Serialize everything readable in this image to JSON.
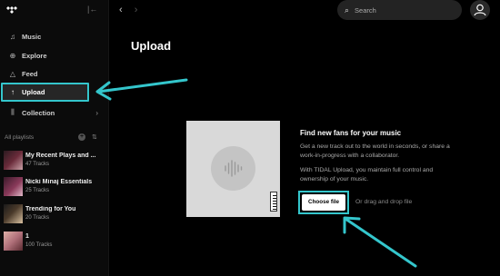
{
  "sidebar": {
    "nav": [
      {
        "label": "Music",
        "icon": "music-note-icon",
        "glyph": "♫"
      },
      {
        "label": "Explore",
        "icon": "globe-icon",
        "glyph": "⊕"
      },
      {
        "label": "Feed",
        "icon": "bell-icon",
        "glyph": "△"
      },
      {
        "label": "Upload",
        "icon": "upload-arrow-icon",
        "glyph": "↑"
      },
      {
        "label": "Collection",
        "icon": "collection-icon",
        "glyph": "⫼"
      }
    ],
    "playlists_header": "All playlists",
    "playlists": [
      {
        "name": "My Recent Plays and ...",
        "sub": "47 Tracks",
        "color": "#6a2b3a"
      },
      {
        "name": "Nicki Minaj Essentials",
        "sub": "25 Tracks",
        "color": "#8a3a5a"
      },
      {
        "name": "Trending for You",
        "sub": "20 Tracks",
        "color": "#4a3a2a"
      },
      {
        "name": "1",
        "sub": "100 Tracks",
        "color": "#b0707a"
      }
    ]
  },
  "topbar": {
    "search_placeholder": "Search",
    "back": "‹",
    "forward": "›"
  },
  "main": {
    "title": "Upload",
    "info_title": "Find new fans for your music",
    "info_p1_l1": "Get a new track out to the world in seconds, or share a",
    "info_p1_l2": "work-in-progress with a collaborator.",
    "info_p2_l1": "With TIDAL Upload, you maintain full control and",
    "info_p2_l2": "ownership of your music.",
    "choose_label": "Choose file",
    "drag_label": "Or drag and drop file"
  },
  "colors": {
    "highlight": "#34c6cc",
    "background": "#000000",
    "sidebar": "#0b0b0b"
  }
}
